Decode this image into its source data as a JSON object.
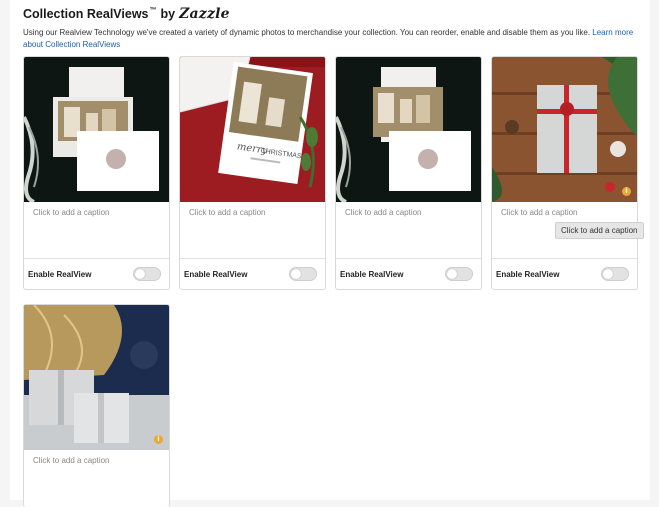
{
  "header": {
    "title": "Collection RealViews",
    "trademark": "™",
    "by": "by",
    "brand": "Zazzle",
    "description": "Using our Realview Technology we've created a variety of dynamic photos to merchandise your collection. You can reorder, enable and disable them as you like.",
    "learn_more": "Learn more about Collection RealViews"
  },
  "cards": [
    {
      "image_alt": "greeting-card-envelope-dark-mockup",
      "caption_placeholder": "Click to add a caption",
      "enable_label": "Enable RealView",
      "enabled": false
    },
    {
      "image_alt": "merry-christmas-card-red-knit-mockup",
      "caption_placeholder": "Click to add a caption",
      "enable_label": "Enable RealView",
      "enabled": false
    },
    {
      "image_alt": "greeting-card-envelope-dark-mockup-2",
      "caption_placeholder": "Click to add a caption",
      "enable_label": "Enable RealView",
      "enabled": false
    },
    {
      "image_alt": "gift-box-wood-table-mockup",
      "caption_placeholder": "Click to add a caption",
      "enable_label": "Enable RealView",
      "enabled": false
    },
    {
      "image_alt": "gift-boxes-christmas-tree-mockup",
      "caption_placeholder": "Click to add a caption"
    }
  ],
  "tooltip": "Click to add a caption",
  "colors": {
    "link": "#1f5fa8",
    "info_badge": "#f2a532",
    "toggle_off": "#e2e2e2"
  }
}
